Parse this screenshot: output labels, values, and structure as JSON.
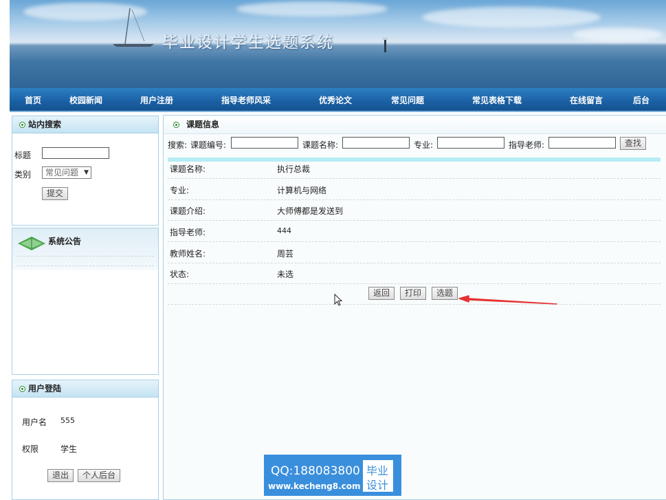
{
  "banner": {
    "title": "毕业设计学生选题系统"
  },
  "nav": [
    "首页",
    "校园新闻",
    "用户注册",
    "指导老师风采",
    "优秀论文",
    "常见问题",
    "常见表格下载",
    "在线留言",
    "后台"
  ],
  "search_panel": {
    "title": "站内搜索",
    "title_label": "标题",
    "title_value": "",
    "category_label": "类别",
    "category_value": "常见问题",
    "submit_label": "提交"
  },
  "notice_panel": {
    "title": "系统公告"
  },
  "login_panel": {
    "title": "用户登陆",
    "username_label": "用户名",
    "username_value": "555",
    "role_label": "权限",
    "role_value": "学生",
    "logout_label": "退出",
    "backend_label": "个人后台"
  },
  "main": {
    "title": "课题信息",
    "search": {
      "prefix": "搜索:",
      "code_label": "课题编号:",
      "name_label": "课题名称:",
      "major_label": "专业:",
      "teacher_label": "指导老师:",
      "find_label": "查找"
    },
    "details": [
      {
        "label": "课题名称:",
        "value": "执行总裁"
      },
      {
        "label": "专业:",
        "value": "计算机与网络"
      },
      {
        "label": "课题介绍:",
        "value": "大师傅都是发送到"
      },
      {
        "label": "指导老师:",
        "value": "444"
      },
      {
        "label": "教师姓名:",
        "value": "周芸"
      },
      {
        "label": "状态:",
        "value": "未选"
      }
    ],
    "buttons": {
      "back": "返回",
      "print": "打印",
      "select": "选题"
    }
  },
  "watermark": {
    "qq": "QQ:188083800",
    "site": "www.kecheng8.com",
    "tag1": "毕业",
    "tag2": "设计"
  }
}
